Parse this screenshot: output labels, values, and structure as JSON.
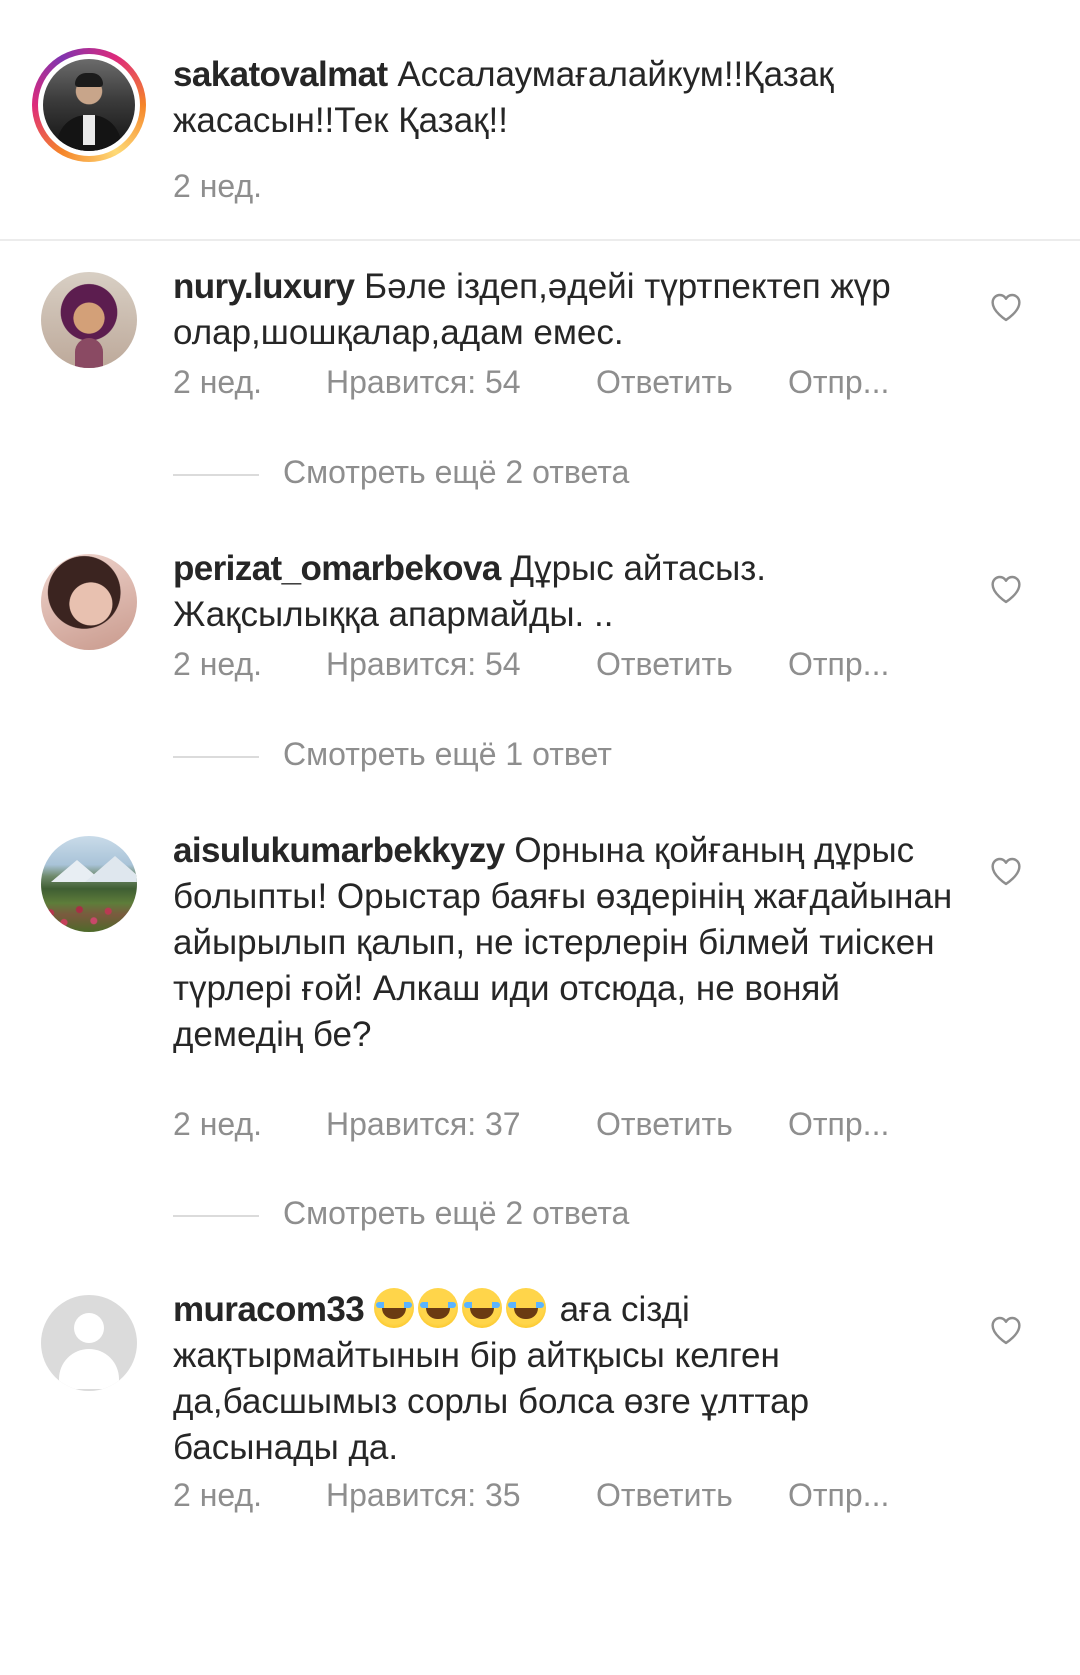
{
  "caption": {
    "username": "sakatovalmat",
    "text": "Ассалаумағалайкум!!Қазақ жасасын!!Тек Қазақ!!",
    "time": "2 нед."
  },
  "comments": [
    {
      "username": "nury.luxury",
      "text": "Бәле іздеп,әдейі түртпектеп жүр олар,шошқалар,адам емес.",
      "time": "2 нед.",
      "likes": "Нравится: 54",
      "reply": "Ответить",
      "send": "Отпр...",
      "more_replies": "Смотреть ещё 2 ответа"
    },
    {
      "username": "perizat_omarbekova",
      "text": "Дұрыс айтасыз. Жақсылыққа апармайды. ..",
      "time": "2 нед.",
      "likes": "Нравится: 54",
      "reply": "Ответить",
      "send": "Отпр...",
      "more_replies": "Смотреть ещё 1 ответ"
    },
    {
      "username": "aisulukumarbekkyzy",
      "text": "Орнына қойғаның дұрыс болыпты! Орыстар баяғы өздерінің жағдайынан айырылып қалып, не істерлерін білмей тиіскен түрлері ғой! Алкаш иди отсюда, не воняй демедің бе?",
      "time": "2 нед.",
      "likes": "Нравится: 37",
      "reply": "Ответить",
      "send": "Отпр...",
      "more_replies": "Смотреть ещё 2 ответа"
    },
    {
      "username": "muracom33",
      "emoji": "😂😂😂😂",
      "text": "аға сізді жақтырмайтынын бір айтқысы келген да,басшымыз сорлы болса өзге ұлттар басынады да.",
      "time": "2 нед.",
      "likes": "Нравится: 35",
      "reply": "Ответить",
      "send": "Отпр..."
    }
  ],
  "icons": {
    "like": "heart-outline-icon",
    "emoji": "face-with-tears-of-joy"
  },
  "colors": {
    "text": "#262626",
    "secondary": "#8e8e8e",
    "divider": "#ececec",
    "reply_line": "#dbdbdb"
  }
}
